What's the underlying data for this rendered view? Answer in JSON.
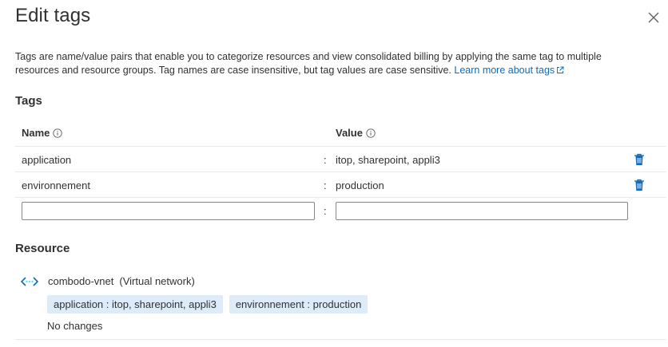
{
  "dialog": {
    "title": "Edit tags",
    "close_icon": "close-icon"
  },
  "description": {
    "text": "Tags are name/value pairs that enable you to categorize resources and view consolidated billing by applying the same tag to multiple resources and resource groups. Tag names are case insensitive, but tag values are case sensitive. ",
    "link_label": "Learn more about tags",
    "link_icon": "external-link-icon"
  },
  "tags_section": {
    "title": "Tags",
    "columns": {
      "name": "Name",
      "value": "Value"
    },
    "separator": ":",
    "rows": [
      {
        "name": "application",
        "value": "itop, sharepoint, appli3"
      },
      {
        "name": "environnement",
        "value": "production"
      }
    ],
    "new_row": {
      "name": "",
      "value": ""
    }
  },
  "resource_section": {
    "title": "Resource",
    "resource_name": "combodo-vnet",
    "resource_type": "(Virtual network)",
    "chips": [
      "application : itop, sharepoint, appli3",
      "environnement : production"
    ],
    "status": "No changes"
  },
  "colors": {
    "accent": "#0f6cbd",
    "chip_bg": "#deecf9",
    "text": "#323130",
    "divider": "#edebe9"
  }
}
